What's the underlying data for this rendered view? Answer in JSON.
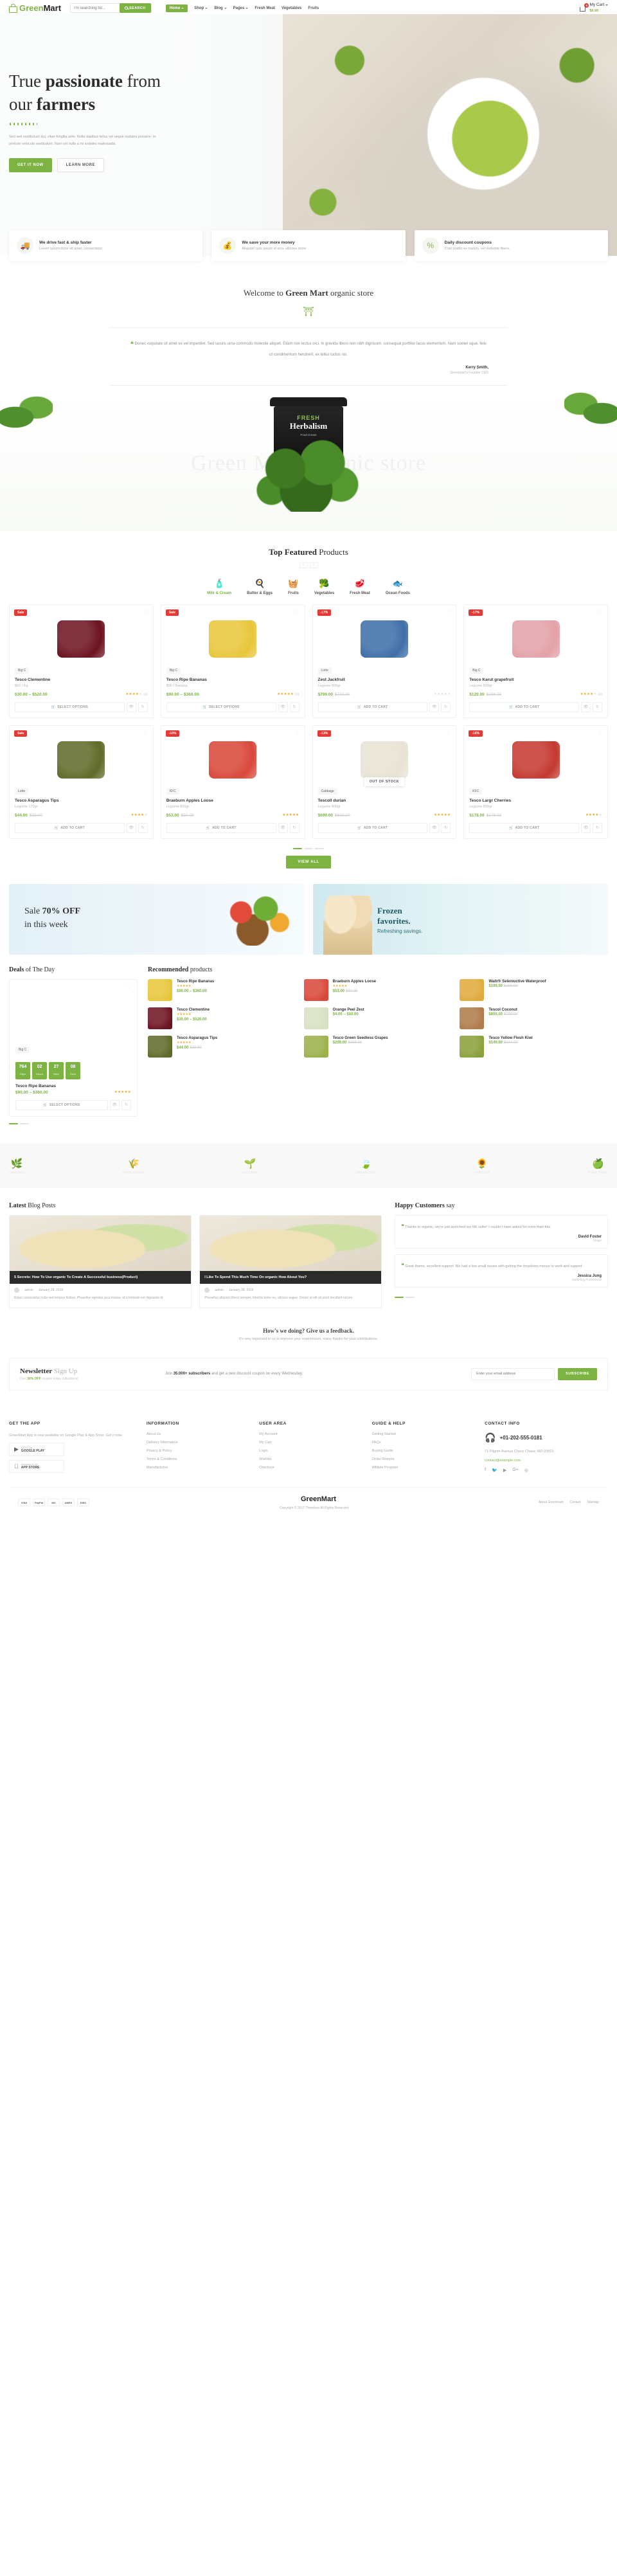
{
  "header": {
    "logo_text_green": "Green",
    "logo_text_dark": "Mart",
    "search_placeholder": "I'm searching for...",
    "search_button": "SEARCH",
    "nav": [
      {
        "label": "Home",
        "caret": true,
        "active": true
      },
      {
        "label": "Shop",
        "caret": true,
        "active": false
      },
      {
        "label": "Blog",
        "caret": true,
        "active": false
      },
      {
        "label": "Pages",
        "caret": true,
        "active": false
      },
      {
        "label": "Fresh Meat",
        "caret": false,
        "active": false
      },
      {
        "label": "Vegetables",
        "caret": false,
        "active": false
      },
      {
        "label": "Fruits",
        "caret": false,
        "active": false
      }
    ],
    "cart_label": "My Cart",
    "cart_count": "0",
    "cart_price": "$0.00"
  },
  "hero": {
    "title_plain_1": "True ",
    "title_bold_1": "passionate",
    "title_plain_2": " from",
    "title_plain_3": "our ",
    "title_bold_2": "farmers",
    "paragraph": "Sed sed vestibulum dui, vitae fringilla ante. Nulla dapibus tellus vel neque sodales posuere. In pretium vehicula vestibulum. Nam vel nulla a mi sodales malesuada.",
    "btn_primary": "GET IT NOW",
    "btn_secondary": "LEARN MORE"
  },
  "features": [
    {
      "icon": "truck-icon",
      "glyph": "🚚",
      "title": "We drive fast & ship faster",
      "desc": "Lorem ipsum dolor sit amet, consectetur."
    },
    {
      "icon": "money-bag-icon",
      "glyph": "💰",
      "title": "We save your more money",
      "desc": "Aliquam quis ipsum id eros ultricies more"
    },
    {
      "icon": "percent-icon",
      "glyph": "%",
      "title": "Daily discount coupons",
      "desc": "Cras mattis ex mauris, vel molestie libero."
    }
  ],
  "welcome": {
    "plain_1": "Welcome to ",
    "bold": "Green Mart",
    "plain_2": " organic store",
    "quote": "Donec vulputate sit amet ex vel imperdiet. Sed iaculis urna commodo molestie aliquet. Etiam non lectus orci. In gravida libero non nibh dignissim, consequat porttitor lacus elementum. Nam sceleri sque, felis ut condimentum hendrerit, ex tellus luctus nis.",
    "author": "Kerry Smith,",
    "role": "Greenmart's Founder CEO"
  },
  "parallax": {
    "ghost_text": "Green Mart organic store",
    "tub_line1": "FRESH",
    "tub_line2": "Herbalism",
    "tub_line3": "Food Cream"
  },
  "featured": {
    "title_bold": "Top Featured",
    "title_plain": " Products",
    "prev": "‹",
    "next": "›",
    "tabs": [
      {
        "label": "Milk & Cream",
        "glyph": "🧴",
        "active": true
      },
      {
        "label": "Butter & Eggs",
        "glyph": "🍳",
        "active": false
      },
      {
        "label": "Fruits",
        "glyph": "🧺",
        "active": false
      },
      {
        "label": "Vegetables",
        "glyph": "🥦",
        "active": false
      },
      {
        "label": "Fresh Meat",
        "glyph": "🥩",
        "active": false
      },
      {
        "label": "Ocean Foods",
        "glyph": "🐟",
        "active": false
      }
    ],
    "products": [
      {
        "tag": "Sale",
        "tag_type": "sale",
        "brand": "Big C",
        "name": "Tesco Clementine",
        "unit": "$60 / Kg",
        "price": "$30.00 – $520.00",
        "old": "",
        "stars": 4,
        "count": "(3)",
        "action": "SELECT OPTIONS",
        "color": "#6d1220",
        "oos": false
      },
      {
        "tag": "Sale",
        "tag_type": "sale",
        "brand": "Big C",
        "name": "Tesco Ripe Bananas",
        "unit": "$90 / Banana",
        "price": "$90.00 – $360.00",
        "old": "",
        "stars": 5,
        "count": "(4)",
        "action": "SELECT OPTIONS",
        "color": "#e8c63a",
        "oos": false
      },
      {
        "tag": "-17%",
        "tag_type": "disc",
        "brand": "Lotte",
        "name": "Zest Jackfruit",
        "unit": "Legume 800gr",
        "price": "$799.00",
        "old": "$733.00",
        "stars": 0,
        "count": "",
        "action": "ADD TO CART",
        "color": "#3f6fa8",
        "oos": false
      },
      {
        "tag": "-17%",
        "tag_type": "disc",
        "brand": "Big C",
        "name": "Tesco Karut grapefruit",
        "unit": "Legume 800gr",
        "price": "$120.00",
        "old": "$108.00",
        "stars": 4,
        "count": "(3)",
        "action": "ADD TO CART",
        "color": "#e3a2a8",
        "oos": false
      },
      {
        "tag": "Sale",
        "tag_type": "sale",
        "brand": "Lotte",
        "name": "Tesco Asparagus Tips",
        "unit": "Legume 170gr",
        "price": "$44.00",
        "old": "$39.00",
        "stars": 4,
        "count": "",
        "action": "ADD TO CART",
        "color": "#5f6b2a",
        "oos": false
      },
      {
        "tag": "-10%",
        "tag_type": "disc",
        "brand": "KFC",
        "name": "Braeburn Apples Loose",
        "unit": "Legume 800gr",
        "price": "$53.00",
        "old": "$30.00",
        "stars": 5,
        "count": "",
        "action": "ADD TO CART",
        "color": "#d9483a",
        "oos": false
      },
      {
        "tag": "-13%",
        "tag_type": "disc",
        "brand": "Cabbage",
        "name": "Tescoll durian",
        "unit": "Legume 800gr",
        "price": "$699.00",
        "old": "$633.00",
        "stars": 5,
        "count": "",
        "action": "ADD TO CART",
        "color": "#e8e3d4",
        "oos": true
      },
      {
        "tag": "-16%",
        "tag_type": "disc",
        "brand": "KFC",
        "name": "Tesco Largr Cherries",
        "unit": "Legume 800gr",
        "price": "$178.00",
        "old": "$178.00",
        "stars": 4,
        "count": "",
        "action": "ADD TO CART",
        "color": "#c4392f",
        "oos": false
      }
    ],
    "view_all": "VIEW ALL"
  },
  "banners": [
    {
      "line1_plain": "Sale ",
      "line1_bold": "70% OFF",
      "line2": "in this week"
    },
    {
      "line1": "Frozen",
      "line2": "favorites.",
      "line3": "Refreshing savings."
    }
  ],
  "deals": {
    "title_bold": "Deals",
    "title_plain": " of The Day",
    "brand": "Big C",
    "countdown": [
      {
        "value": "764",
        "unit": "Days"
      },
      {
        "value": "02",
        "unit": "Hours"
      },
      {
        "value": "27",
        "unit": "Mins"
      },
      {
        "value": "08",
        "unit": "Secs"
      }
    ],
    "name": "Tesco Ripe Bananas",
    "price": "$90.00 – $360.00",
    "stars": 5,
    "action": "SELECT OPTIONS"
  },
  "recommended": {
    "title_bold": "Recommended",
    "title_plain": " products",
    "items": [
      {
        "name": "Tesco Ripe Bananas",
        "unit": "",
        "price": "$90.00 – $360.00",
        "old": "",
        "stars": 5,
        "color": "#e8c63a"
      },
      {
        "name": "Braeburn Apples Loose",
        "unit": "",
        "price": "$53.00",
        "old": "$30.00",
        "stars": 5,
        "color": "#d9483a"
      },
      {
        "name": "Waitrfr Seleniuctive Waterproof",
        "unit": "",
        "price": "$199.00",
        "old": "$150.00",
        "stars": 0,
        "color": "#e0ab3c"
      },
      {
        "name": "Tesco Clementine",
        "unit": "",
        "price": "$30.00 – $520.00",
        "old": "",
        "stars": 4,
        "color": "#6d1220"
      },
      {
        "name": "Orange Peel Zest",
        "unit": "",
        "price": "$4.00 – $10.00",
        "old": "",
        "stars": 0,
        "color": "#d8e0c2"
      },
      {
        "name": "Tescol Coconut",
        "unit": "",
        "price": "$800.00",
        "old": "$720.00",
        "stars": 0,
        "color": "#b07a49"
      },
      {
        "name": "Tesco Asparagus Tips",
        "unit": "",
        "price": "$44.00",
        "old": "$39.00",
        "stars": 4,
        "color": "#5f6b2a"
      },
      {
        "name": "Tesco Green Seedless Grapes",
        "unit": "",
        "price": "$259.00",
        "old": "$233.00",
        "stars": 0,
        "color": "#9cb04a"
      },
      {
        "name": "Tesco Yellow Flesh Kiwi",
        "unit": "",
        "price": "$149.00",
        "old": "$134.00",
        "stars": 0,
        "color": "#8aa03a"
      }
    ]
  },
  "brands": [
    {
      "glyph": "🌿",
      "label": "ORGANIC"
    },
    {
      "glyph": "🌾",
      "label": "FARM FRESH"
    },
    {
      "glyph": "🌱",
      "label": "NATURAL"
    },
    {
      "glyph": "🍃",
      "label": "GREEN LIFE"
    },
    {
      "glyph": "🌻",
      "label": "HARVEST"
    },
    {
      "glyph": "🍏",
      "label": "PURE FOOD"
    }
  ],
  "blog": {
    "title_bold": "Latest",
    "title_plain": " Blog Posts",
    "posts": [
      {
        "headline": "5 Secrets: How To Use organic To Create A Successful business(Product)",
        "author": "admin",
        "date": "January 28, 2016",
        "excerpt": "Etiam consectetur nulla sed tempus finibus. Phasellus egestas arcu massa, id commodo est dignissim id."
      },
      {
        "headline": "I Like To Spend This Much Time On organic How About You?",
        "author": "admin",
        "date": "January 28, 2016",
        "excerpt": "Phasellus aliquam libero semper, lobortis tortor eu, ultrices augue. Donec ut elit sit amet tincidunt rutrum."
      }
    ]
  },
  "customers": {
    "title_bold": "Happy Customers",
    "title_plain": " say",
    "items": [
      {
        "text": "Thanks to organic, we're just launched our 5th seller! I couldn't have asked for more than this.",
        "name": "David Foster",
        "role": "Singer"
      },
      {
        "text": "Great theme, excellent support. We had a few small issues with getting the dropdown menus to work and support",
        "name": "Jessica Jung",
        "role": "Marketing Professional"
      }
    ]
  },
  "feedback": {
    "heading": "How's we doing? Give us a feedback.",
    "sub": "It's very important to us to improve your experiences, many thanks for your contributions."
  },
  "newsletter": {
    "title_bold": "Newsletter",
    "title_plain": " Sign Up",
    "sub_pre": "(Get ",
    "sub_green": "30% OFF",
    "sub_post": " coupon today subscibers)",
    "msg_pre": "Join ",
    "msg_bold": "35.000+ subscribers",
    "msg_post": " and get a new discount coupon on every Wednesday.",
    "placeholder": "Enter your email address",
    "button": "SUBSCRIBE"
  },
  "footer": {
    "app": {
      "title": "GET THE APP",
      "desc": "GreenMart App is now available on Google Play & App Store. Get it now.",
      "buttons": [
        {
          "glyph": "▶",
          "small": "GET IT ON",
          "big": "GOOGLE PLAY"
        },
        {
          "glyph": "",
          "small": "Download on the",
          "big": "APP STORE"
        }
      ]
    },
    "columns": [
      {
        "title": "INFORMATION",
        "items": [
          "About Us",
          "Delivery Information",
          "Privacy & Policy",
          "Terms & Conditions",
          "Manufactures"
        ]
      },
      {
        "title": "USER AREA",
        "items": [
          "My Account",
          "My Cart",
          "Login",
          "Wishlist",
          "Checkout"
        ]
      },
      {
        "title": "GUIDE & HELP",
        "items": [
          "Getting Started",
          "FAQs",
          "Buying Guide",
          "Order Returns",
          "Affiliate Program"
        ]
      }
    ],
    "contact": {
      "title": "CONTACT INFO",
      "phone": "+01-202-555-0181",
      "address": "71 Pilgrim Avenue Chevy Chase, MD 20815",
      "email": "contact@example.com",
      "socials": [
        "f",
        "🐦",
        "▶",
        "G+",
        "◎"
      ]
    },
    "payments": [
      "VISA",
      "PayPal",
      "MC",
      "AMEX",
      "DISC"
    ],
    "logo_green": "Green",
    "logo_dark": "Mart",
    "copyright": "Copyright © 2017 Themless All Rights Reserved",
    "links": [
      "About Greenmart",
      "Contact",
      "Sitemap"
    ]
  }
}
